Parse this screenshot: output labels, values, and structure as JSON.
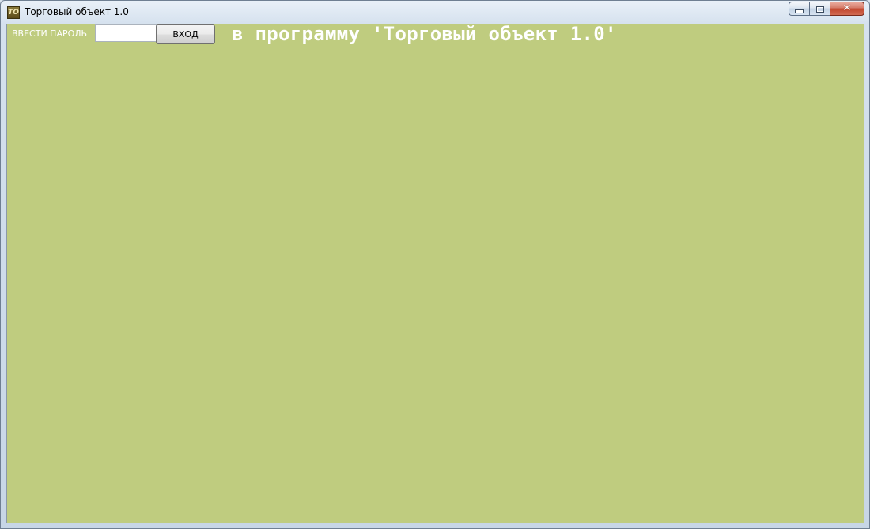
{
  "window": {
    "title": "Торговый объект 1.0",
    "icon_text": "ТО",
    "icon": "app-icon",
    "controls": {
      "minimize_icon": "minimize-icon",
      "maximize_icon": "maximize-icon",
      "close_icon": "close-icon",
      "close_glyph": "✕"
    }
  },
  "login": {
    "label": "ВВЕСТИ ПАРОЛЬ",
    "password_value": "",
    "button_label": "ВХОД"
  },
  "welcome_text": "в программу 'Торговый объект 1.0'",
  "colors": {
    "client_background": "#bfcc7f",
    "welcome_text": "#ffffff",
    "close_button": "#c2452c"
  }
}
